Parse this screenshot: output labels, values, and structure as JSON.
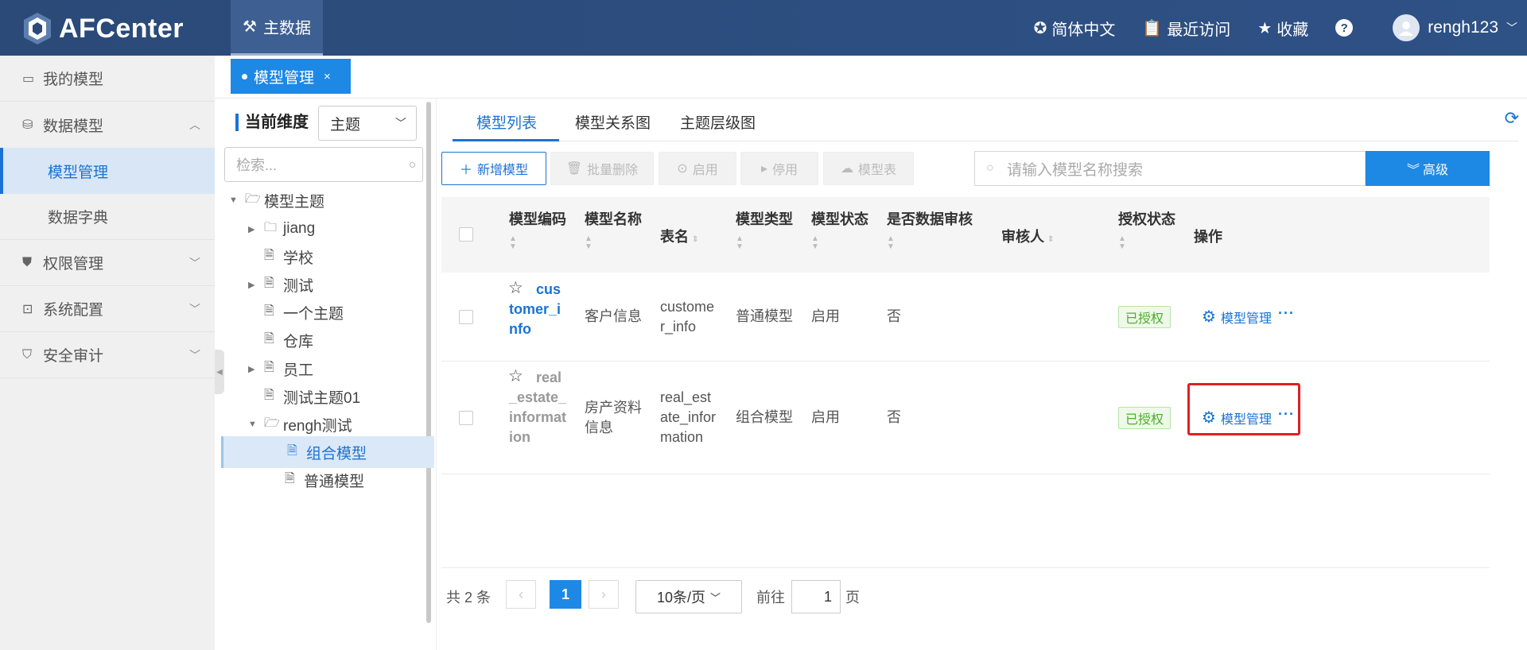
{
  "app": {
    "name": "AFCenter",
    "top_nav": "主数据"
  },
  "header": {
    "language": "简体中文",
    "recent": "最近访问",
    "favorites": "收藏",
    "help": "?",
    "username": "rengh123"
  },
  "sidebar": {
    "items": [
      {
        "label": "我的模型"
      },
      {
        "label": "数据模型"
      },
      {
        "label": "模型管理"
      },
      {
        "label": "数据字典"
      },
      {
        "label": "权限管理"
      },
      {
        "label": "系统配置"
      },
      {
        "label": "安全审计"
      }
    ]
  },
  "page_tab": {
    "label": "模型管理",
    "close": "×"
  },
  "tree": {
    "dimension_label": "当前维度",
    "dimension_value": "主题",
    "search_placeholder": "检索...",
    "nodes": [
      "模型主题",
      "jiang",
      "学校",
      "测试",
      "一个主题",
      "仓库",
      "员工",
      "测试主题01",
      "rengh测试",
      "组合模型",
      "普通模型"
    ]
  },
  "main": {
    "tabs": [
      "模型列表",
      "模型关系图",
      "主题层级图"
    ],
    "toolbar": {
      "add": "新增模型",
      "batch_delete": "批量删除",
      "enable": "启用",
      "disable": "停用",
      "model_table": "模型表",
      "search_placeholder": "请输入模型名称搜索",
      "advanced": "高级"
    },
    "columns": [
      "模型编码",
      "模型名称",
      "表名",
      "模型类型",
      "模型状态",
      "是否数据审核",
      "审核人",
      "授权状态",
      "操作"
    ],
    "rows": [
      {
        "code_lines": [
          "cus",
          "tomer_i",
          "nfo"
        ],
        "name_lines": [
          "客户信息"
        ],
        "table_lines": [
          "custome",
          "r_info"
        ],
        "type": "普通模型",
        "status": "启用",
        "audit": "否",
        "auditor": "",
        "auth": "已授权",
        "op": "模型管理"
      },
      {
        "code_lines": [
          "real",
          "_estate_",
          "informat",
          "ion"
        ],
        "name_lines": [
          "房产资料",
          "信息"
        ],
        "table_lines": [
          "real_est",
          "ate_infor",
          "mation"
        ],
        "type": "组合模型",
        "status": "启用",
        "audit": "否",
        "auditor": "",
        "auth": "已授权",
        "op": "模型管理"
      }
    ],
    "pagination": {
      "total": "共 2 条",
      "current_page": "1",
      "page_size": "10条/页",
      "goto_label": "前往",
      "goto_value": "1",
      "page_suffix": "页"
    }
  },
  "colors": {
    "header_bg": "#2b4a78",
    "accent": "#1a73d4",
    "highlight": "#e02020",
    "auth_green": "#4cae2a"
  }
}
